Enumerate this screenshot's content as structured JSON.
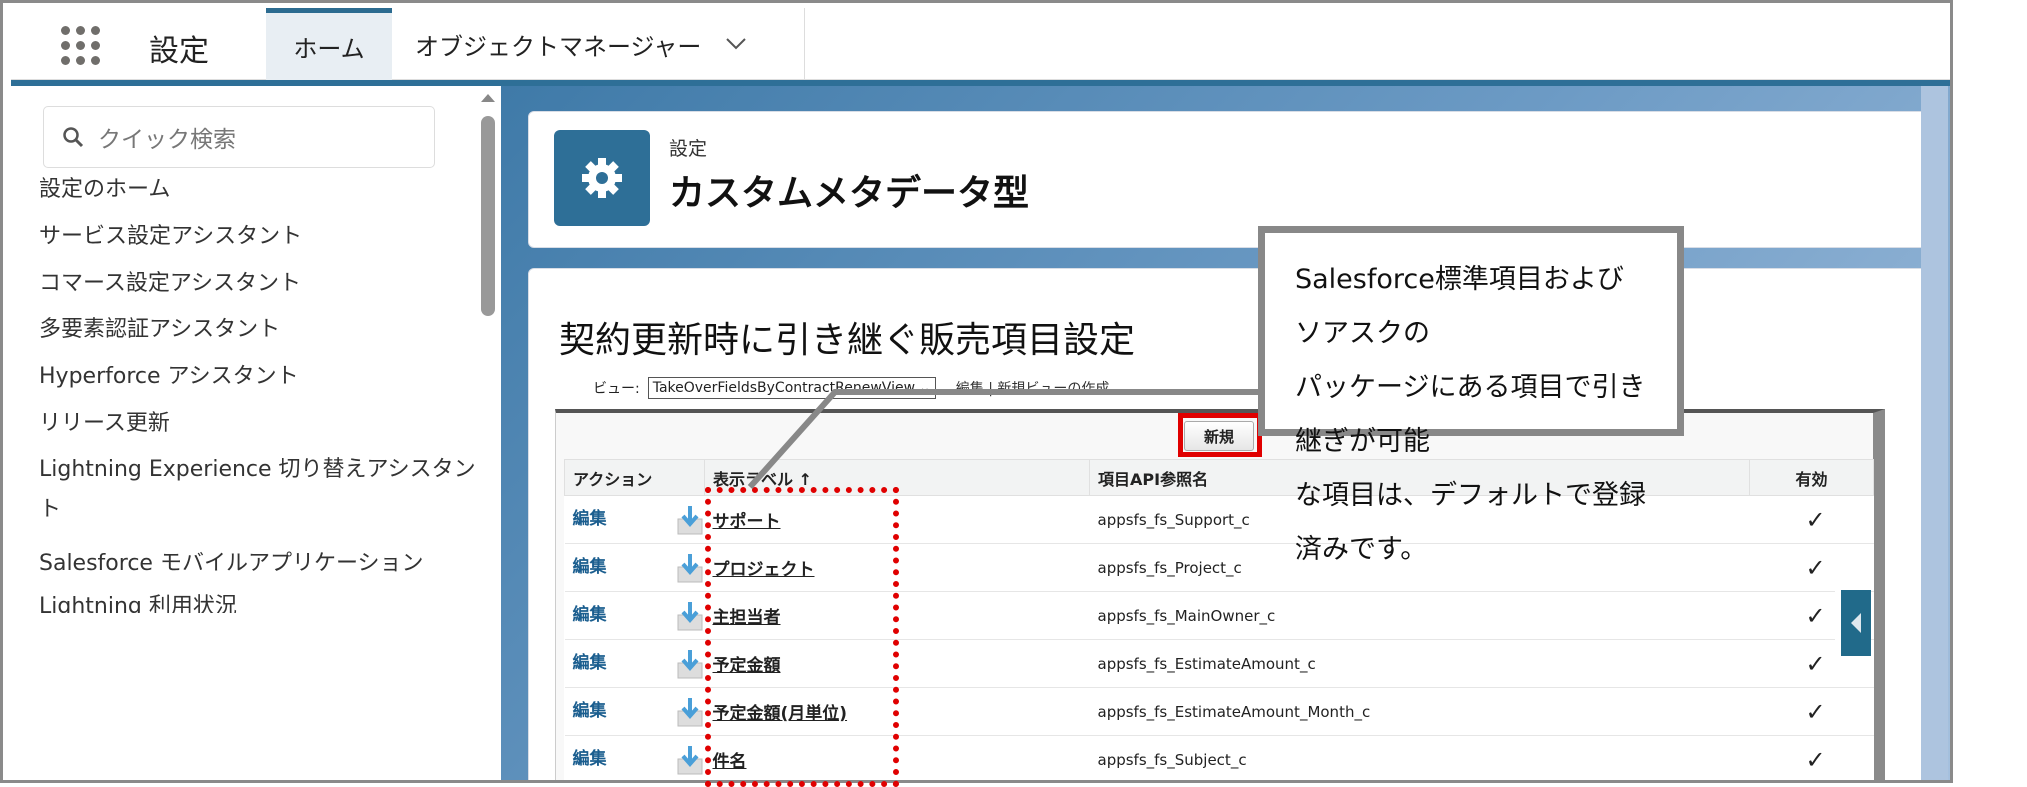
{
  "header": {
    "app_name": "設定",
    "tabs": [
      {
        "label": "ホーム",
        "active": true
      },
      {
        "label": "オブジェクトマネージャー",
        "has_dropdown": true
      }
    ]
  },
  "sidebar": {
    "search_placeholder": "クイック検索",
    "items": [
      "設定のホーム",
      "サービス設定アシスタント",
      "コマース設定アシスタント",
      "多要素認証アシスタント",
      "Hyperforce アシスタント",
      "リリース更新",
      "Lightning Experience 切り替えアシスタント",
      "Salesforce モバイルアプリケーション",
      "Lightning 利用状況"
    ]
  },
  "page_header": {
    "breadcrumb": "設定",
    "title": "カスタムメタデータ型",
    "icon": "gear-icon"
  },
  "content": {
    "title": "契約更新時に引き継ぐ販売項目設定",
    "view_label": "ビュー:",
    "view_selected": "TakeOverFieldsByContractRenewView",
    "view_links": "編集 | 新規ビューの作成",
    "new_button": "新規",
    "columns": [
      "アクション",
      "表示ラベル ↑",
      "項目API参照名",
      "有効"
    ],
    "rows": [
      {
        "action": "編集",
        "label": "サポート",
        "api": "appsfs_fs_Support_c",
        "active": true
      },
      {
        "action": "編集",
        "label": "プロジェクト",
        "api": "appsfs_fs_Project_c",
        "active": true
      },
      {
        "action": "編集",
        "label": "主担当者",
        "api": "appsfs_fs_MainOwner_c",
        "active": true
      },
      {
        "action": "編集",
        "label": "予定金額",
        "api": "appsfs_fs_EstimateAmount_c",
        "active": true
      },
      {
        "action": "編集",
        "label": "予定金額(月単位)",
        "api": "appsfs_fs_EstimateAmount_Month_c",
        "active": true
      },
      {
        "action": "編集",
        "label": "件名",
        "api": "appsfs_fs_Subject_c",
        "active": true
      }
    ]
  },
  "callout": {
    "lines": [
      "Salesforce標準項目およびソアスクの",
      "パッケージにある項目で引き継ぎが可能",
      "な項目は、デフォルトで登録済みです。"
    ]
  },
  "colors": {
    "brand": "#2e6f97",
    "highlight": "#e00000",
    "link": "#1b5e8f"
  }
}
